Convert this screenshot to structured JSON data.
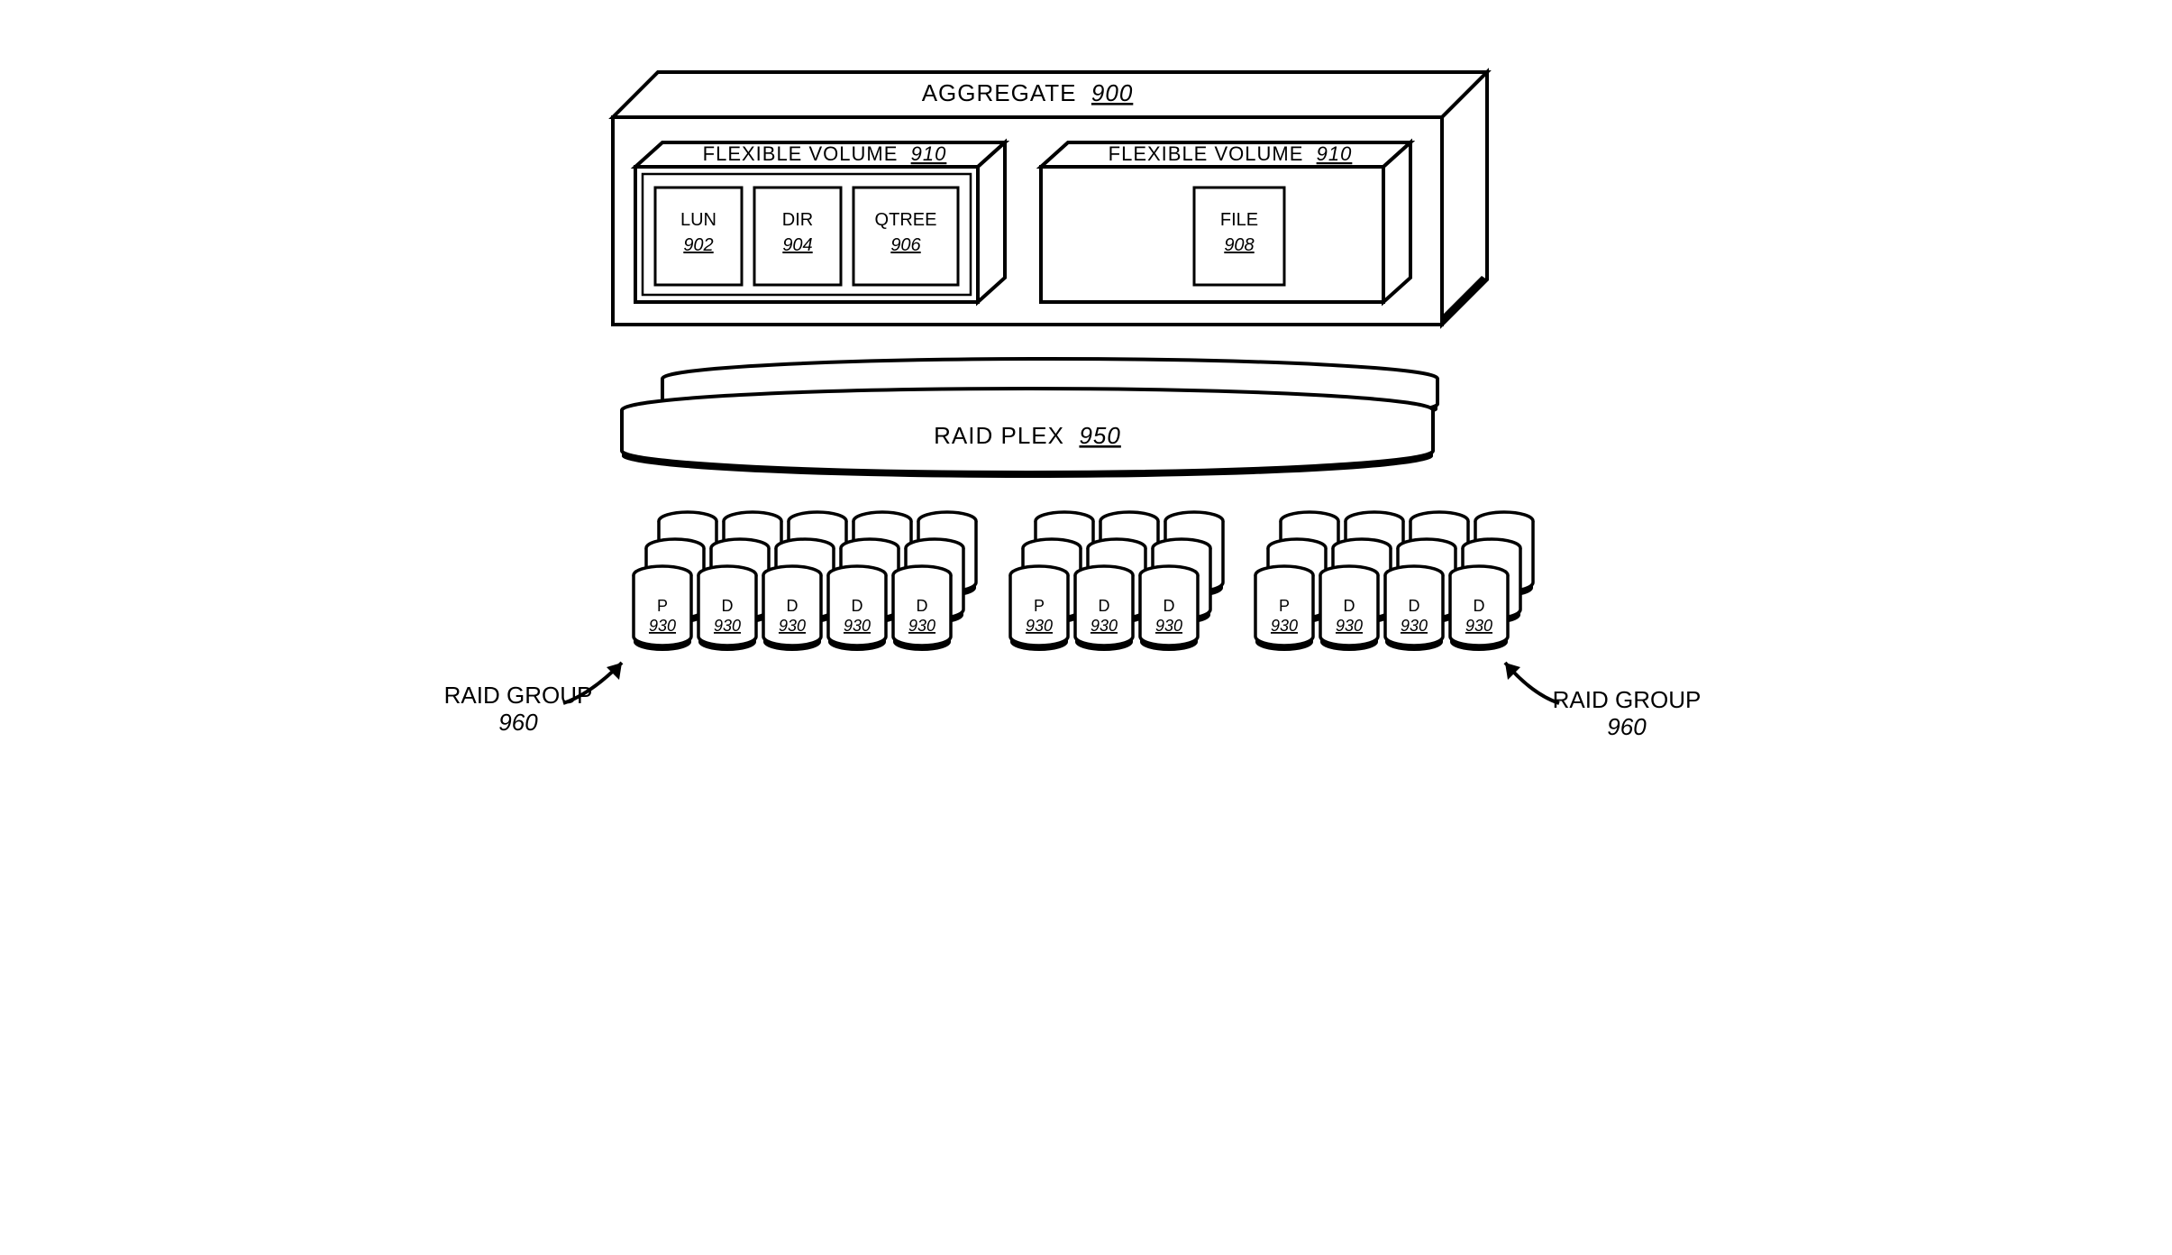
{
  "aggregate": {
    "label": "AGGREGATE",
    "ref": "900"
  },
  "flexvol": {
    "label": "FLEXIBLE VOLUME",
    "ref": "910"
  },
  "lun": {
    "label": "LUN",
    "ref": "902"
  },
  "dir": {
    "label": "DIR",
    "ref": "904"
  },
  "qtree": {
    "label": "QTREE",
    "ref": "906"
  },
  "file": {
    "label": "FILE",
    "ref": "908"
  },
  "plex": {
    "label": "RAID PLEX",
    "ref": "950"
  },
  "disk": {
    "p": "P",
    "d": "D",
    "ref": "930"
  },
  "raidgroup": {
    "label": "RAID GROUP",
    "ref": "960"
  }
}
